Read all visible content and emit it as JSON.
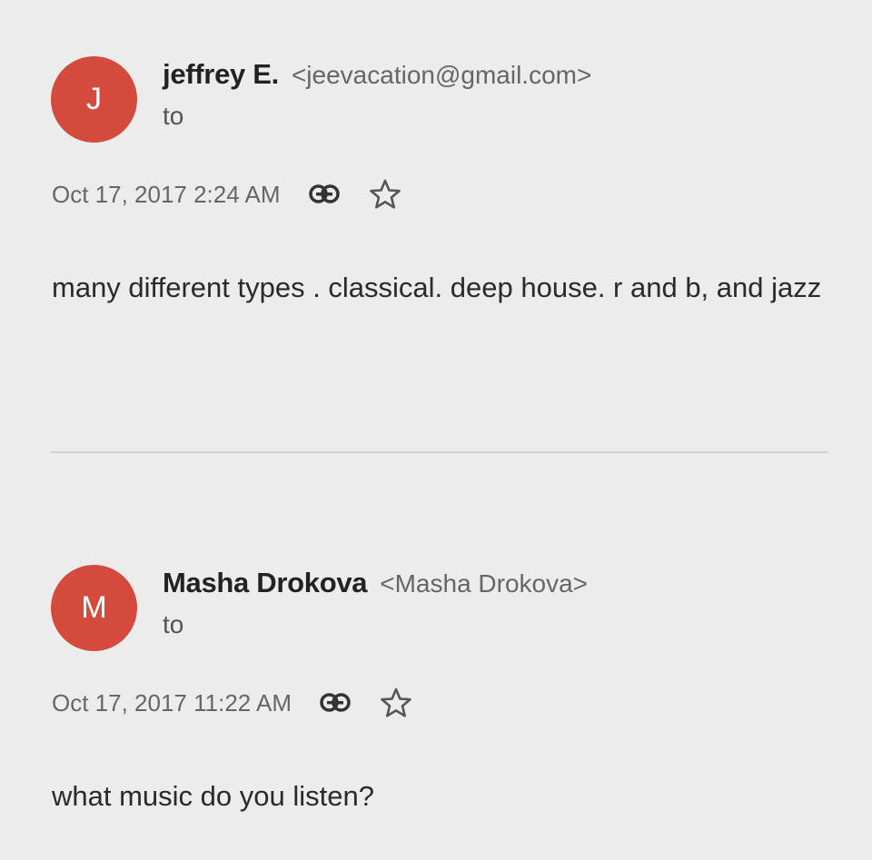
{
  "messages": [
    {
      "avatar_letter": "J",
      "sender_name": "jeffrey E.",
      "sender_email": "<jeevacation@gmail.com>",
      "to_label": "to",
      "timestamp": "Oct 17, 2017 2:24 AM",
      "link_icon": "link-icon",
      "star_icon": "star-icon",
      "body": "many different types . classical. deep house. r and b, and jazz"
    },
    {
      "avatar_letter": "M",
      "sender_name": "Masha Drokova",
      "sender_email": "<Masha Drokova>",
      "to_label": "to",
      "timestamp": "Oct 17, 2017 11:22 AM",
      "link_icon": "link-icon",
      "star_icon": "star-icon",
      "body": "what music do you listen?"
    }
  ],
  "colors": {
    "avatar": "#d44a3d",
    "background": "#ececec"
  }
}
